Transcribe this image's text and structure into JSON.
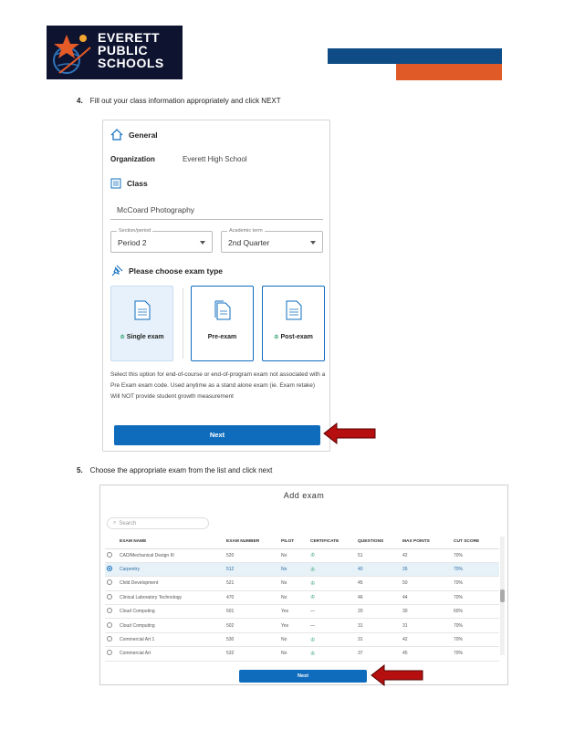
{
  "header": {
    "logo_lines": [
      "EVERETT",
      "PUBLIC",
      "SCHOOLS"
    ],
    "colors": {
      "blue": "#0f4c86",
      "orange": "#df5a26",
      "logo_bg": "#0e1330"
    }
  },
  "step4": {
    "number": "4.",
    "text": "Fill  out  your  class  information  appropriately and  click NEXT"
  },
  "form": {
    "general_label": "General",
    "organization_label": "Organization",
    "organization_value": "Everett High School",
    "class_label": "Class",
    "class_value": "McCoard Photography",
    "section_caption": "Section/period",
    "section_value": "Period 2",
    "academic_caption": "Academic term",
    "academic_value": "2nd Quarter",
    "exam_type_title": "Please choose exam type",
    "exam_types": [
      {
        "label": "Single exam",
        "selected": true
      },
      {
        "label": "Pre-exam",
        "selected": false
      },
      {
        "label": "Post-exam",
        "selected": false
      }
    ],
    "description": "Select this option for end-of-course or end-of-program exam not associated with a Pre Exam exam code. Used anytime as a stand alone exam (ie. Exam retake) Will NOT provide student growth measurement",
    "next_label": "Next"
  },
  "step5": {
    "number": "5.",
    "text": "Choose  the  appropriate exam  from  the  list  and  click next"
  },
  "add_exam": {
    "title": "Add exam",
    "search_placeholder": "Search",
    "columns": [
      "EXAM NAME",
      "EXAM NUMBER",
      "PILOT",
      "CERTIFICATE",
      "QUESTIONS",
      "MAX POINTS",
      "CUT SCORE"
    ],
    "rows": [
      {
        "selected": false,
        "name": "CAD/Mechanical Design III",
        "number": "520",
        "pilot": "No",
        "cert": true,
        "questions": "51",
        "max": "42",
        "cut": "70%"
      },
      {
        "selected": true,
        "name": "Carpentry",
        "number": "512",
        "pilot": "No",
        "cert": true,
        "questions": "40",
        "max": "26",
        "cut": "70%"
      },
      {
        "selected": false,
        "name": "Child Development",
        "number": "521",
        "pilot": "No",
        "cert": true,
        "questions": "45",
        "max": "50",
        "cut": "70%"
      },
      {
        "selected": false,
        "name": "Clinical Laboratory Technology",
        "number": "470",
        "pilot": "No",
        "cert": true,
        "questions": "46",
        "max": "44",
        "cut": "70%"
      },
      {
        "selected": false,
        "name": "Cloud Computing",
        "number": "501",
        "pilot": "Yes",
        "cert": false,
        "questions": "20",
        "max": "30",
        "cut": "60%"
      },
      {
        "selected": false,
        "name": "Cloud Computing",
        "number": "502",
        "pilot": "Yes",
        "cert": false,
        "questions": "31",
        "max": "31",
        "cut": "70%"
      },
      {
        "selected": false,
        "name": "Commercial Art 1",
        "number": "530",
        "pilot": "No",
        "cert": true,
        "questions": "31",
        "max": "42",
        "cut": "70%"
      },
      {
        "selected": false,
        "name": "Commercial Art",
        "number": "532",
        "pilot": "No",
        "cert": true,
        "questions": "37",
        "max": "45",
        "cut": "70%"
      }
    ],
    "next_label": "Next"
  }
}
